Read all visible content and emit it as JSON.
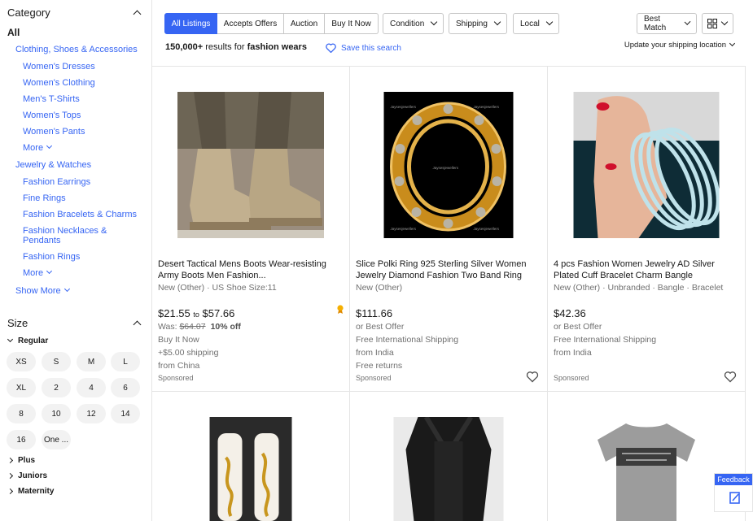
{
  "sidebar": {
    "category_heading": "Category",
    "all_label": "All",
    "cat1": "Clothing, Shoes & Accessories",
    "cat1_items": [
      "Women's Dresses",
      "Women's Clothing",
      "Men's T-Shirts",
      "Women's Tops",
      "Women's Pants"
    ],
    "cat1_more": "More",
    "cat2": "Jewelry & Watches",
    "cat2_items": [
      "Fashion Earrings",
      "Fine Rings",
      "Fashion Bracelets & Charms",
      "Fashion Necklaces & Pendants",
      "Fashion Rings"
    ],
    "cat2_more": "More",
    "show_more": "Show More",
    "size_heading": "Size",
    "regular_label": "Regular",
    "sizes": [
      "XS",
      "S",
      "M",
      "L",
      "XL",
      "2",
      "4",
      "6",
      "8",
      "10",
      "12",
      "14",
      "16",
      "One ..."
    ],
    "plus_label": "Plus",
    "juniors_label": "Juniors",
    "maternity_label": "Maternity"
  },
  "toolbar": {
    "tabs": [
      "All Listings",
      "Accepts Offers",
      "Auction",
      "Buy It Now"
    ],
    "filters": [
      "Condition",
      "Shipping",
      "Local"
    ],
    "sort_label": "Best Match",
    "results_count": "150,000+",
    "results_mid": " results for ",
    "query": "fashion wears",
    "save_search": "Save this search",
    "update_shipping": "Update your shipping location"
  },
  "products": [
    {
      "title": "Desert Tactical Mens Boots Wear-resisting Army Boots Men Fashion...",
      "subtitle": "New (Other) · US Shoe Size:11",
      "price_low": "$21.55",
      "price_to": "to",
      "price_high": "$57.66",
      "was_label": "Was:",
      "was_price": "$64.07",
      "discount": "10% off",
      "buy_it_now": "Buy It Now",
      "shipping": "+$5.00 shipping",
      "origin": "from China",
      "sponsored": "Sponsored"
    },
    {
      "title": "Slice Polki Ring 925 Sterling Silver Women Jewelry Diamond Fashion Two Band Ring",
      "subtitle": "New (Other)",
      "price": "$111.66",
      "best_offer": "or Best Offer",
      "shipping": "Free International Shipping",
      "origin": "from India",
      "returns": "Free returns",
      "sponsored": "Sponsored",
      "watermark": "Jaysesjewellers"
    },
    {
      "title": "4 pcs Fashion Women Jewelry AD Silver Plated Cuff Bracelet Charm Bangle",
      "subtitle": "New (Other) · Unbranded · Bangle · Bracelet",
      "price": "$42.36",
      "best_offer": "or Best Offer",
      "shipping": "Free International Shipping",
      "origin": "from India",
      "sponsored": "Sponsored"
    }
  ],
  "feedback_label": "Feedback",
  "colors": {
    "accent": "#3665f3",
    "text": "#191919",
    "muted": "#707070",
    "border": "#e5e5e5"
  }
}
